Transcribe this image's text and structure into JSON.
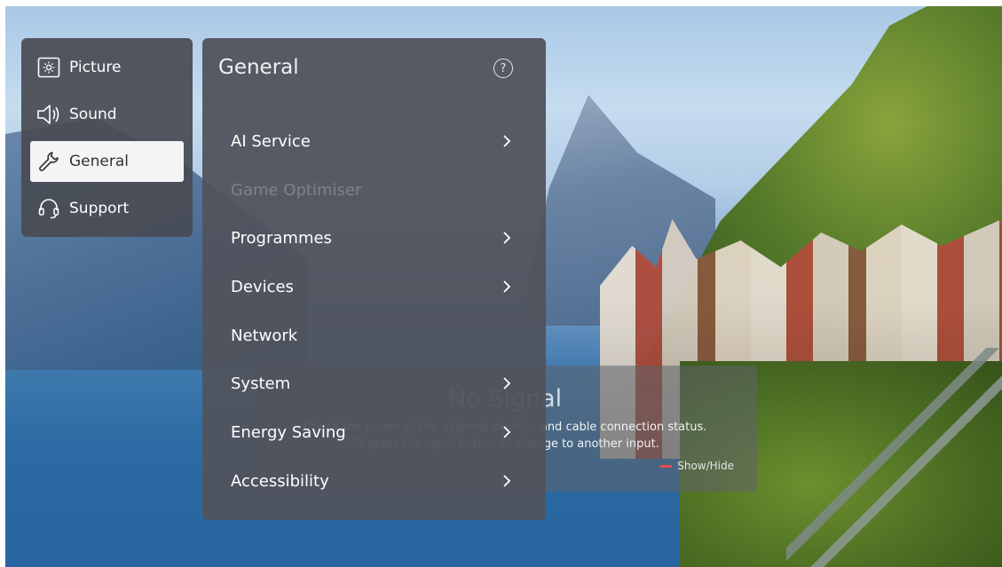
{
  "categories": [
    {
      "label": "Picture",
      "icon": "picture-icon"
    },
    {
      "label": "Sound",
      "icon": "speaker-icon"
    },
    {
      "label": "General",
      "icon": "wrench-icon",
      "selected": true
    },
    {
      "label": "Support",
      "icon": "headset-icon"
    }
  ],
  "panel": {
    "title": "General",
    "help_symbol": "?",
    "items": [
      {
        "label": "AI Service",
        "has_submenu": true,
        "enabled": true
      },
      {
        "label": "Game Optimiser",
        "has_submenu": false,
        "enabled": false
      },
      {
        "label": "Programmes",
        "has_submenu": true,
        "enabled": true
      },
      {
        "label": "Devices",
        "has_submenu": true,
        "enabled": true
      },
      {
        "label": "Network",
        "has_submenu": false,
        "enabled": true
      },
      {
        "label": "System",
        "has_submenu": true,
        "enabled": true
      },
      {
        "label": "Energy Saving",
        "has_submenu": true,
        "enabled": true
      },
      {
        "label": "Accessibility",
        "has_submenu": true,
        "enabled": true
      }
    ]
  },
  "no_signal": {
    "title": "No Signal",
    "line1": "Check the power of the external devices and cable connection status.",
    "line2": "Or press the input button to change to another input.",
    "hint_label": "Show/Hide",
    "hint_color": "#e0504e"
  },
  "colors": {
    "selected_bg": "#f4f4f4",
    "panel_bg": "#50535d",
    "disabled_text": "#7e828b"
  }
}
